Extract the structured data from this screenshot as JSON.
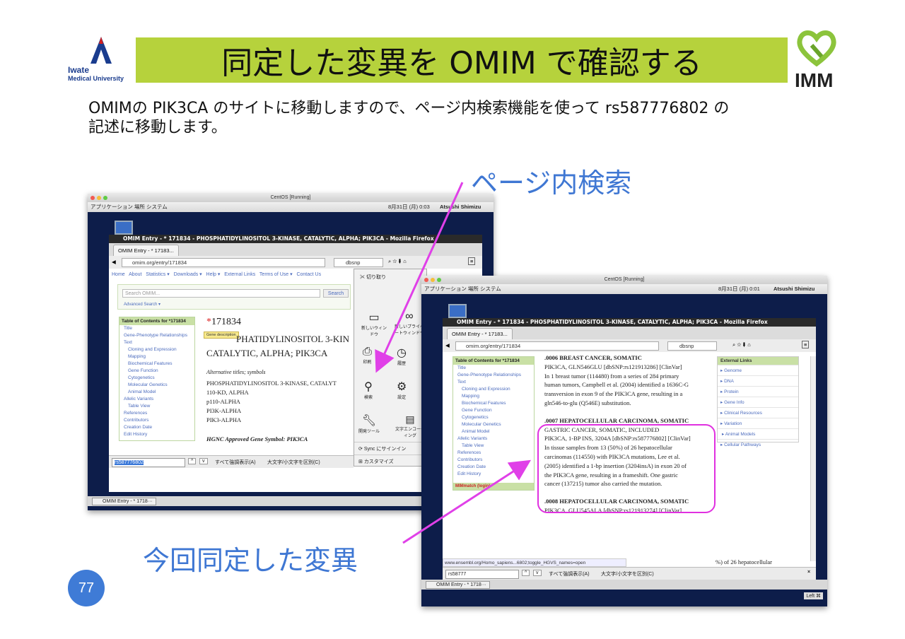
{
  "slide": {
    "logo_left_line1": "Iwate",
    "logo_left_line2": "Medical University",
    "title": "同定した変異を OMIM で確認する",
    "logo_right_text": "IMM",
    "intro_line1": "OMIMの PIK3CA のサイトに移動しますので、ページ内検索機能を使って rs587776802 の",
    "intro_line2": "記述に移動します。",
    "label_search": "ページ内検索",
    "label_mutation": "今回同定した変異",
    "page_number": "77",
    "arrow_color": "#e040e8"
  },
  "left": {
    "window_title": "CentOS [Running]",
    "gnome_menu": "アプリケーション  場所  システム",
    "clock": "8月31日 (月)  0:03",
    "user": "Atsushi Shimizu",
    "firefox_title": "OMIM Entry - * 171834 - PHOSPHATIDYLINOSITOL 3-KINASE, CATALYTIC, ALPHA; PIK3CA - Mozilla Firefox",
    "tab_label": "OMIM Entry - * 17183...",
    "url": "omim.org/entry/171834",
    "search_engine_text": "dbsnp",
    "nav": [
      "Home",
      "About",
      "Statistics ▾",
      "Downloads ▾",
      "Help ▾",
      "External Links",
      "Terms of Use ▾",
      "Contact Us"
    ],
    "search_placeholder": "Search OMIM...",
    "search_button": "Search",
    "advanced_search": "Advanced Search ▾",
    "toc_header": "Table of Contents for *171834",
    "toc": [
      "Title",
      "Gene-Phenotype Relationships",
      "Text",
      "Cloning and Expression",
      "Mapping",
      "Biochemical Features",
      "Gene Function",
      "Cytogenetics",
      "Molecular Genetics",
      "Animal Model",
      "Allelic Variants",
      "Table View",
      "References",
      "Contributors",
      "Creation Date",
      "Edit History"
    ],
    "entry_number": "171834",
    "tooltip": "Gene description",
    "gene_title_1": "PHATIDYLINOSITOL 3-KIN",
    "gene_title_2": "CATALYTIC, ALPHA; PIK3CA",
    "alt_titles": "Alternative titles; symbols",
    "alt_list": [
      "PHOSPHATIDYLINOSITOL 3-KINASE, CATALYT",
      "110-KD, ALPHA",
      "p110-ALPHA",
      "PI3K-ALPHA",
      "PIK3-ALPHA"
    ],
    "hgnc": "HGNC Approved Gene Symbol: PIK3CA",
    "menu_items": [
      "切り取り",
      "新しいウィンドウ",
      "新しいプライベートウィンドウ",
      "印刷",
      "履歴",
      "検索",
      "設定",
      "開発ツール",
      "文字エンコーディング"
    ],
    "menu_sync": "Sync にサインイン",
    "menu_customize": "カスタマイズ",
    "find_value": "rs587776802",
    "find_highlight_all": "すべて強調表示(A)",
    "find_match_case": "大文字/小文字を区別(C)",
    "taskbar_item": "OMIM Entry - * 1718···"
  },
  "right": {
    "window_title": "CentOS [Running]",
    "gnome_menu": "アプリケーション  場所  システム",
    "clock": "8月31日 (月)  0:01",
    "user": "Atsushi Shimizu",
    "firefox_title": "OMIM Entry - * 171834 - PHOSPHATIDYLINOSITOL 3-KINASE, CATALYTIC, ALPHA; PIK3CA - Mozilla Firefox",
    "tab_label": "OMIM Entry - * 17183...",
    "url": "omim.org/entry/171834",
    "search_engine_text": "dbsnp",
    "toc_header": "Table of Contents for *171834",
    "toc": [
      "Title",
      "Gene-Phenotype Relationships",
      "Text",
      "Cloning and Expression",
      "Mapping",
      "Biochemical Features",
      "Gene Function",
      "Cytogenetics",
      "Molecular Genetics",
      "Animal Model",
      "Allelic Variants",
      "Table View",
      "References",
      "Contributors",
      "Creation Date",
      "Edit History"
    ],
    "mimmatch": "MIMmatch (login)",
    "v6_title": ".0006  BREAST CANCER, SOMATIC",
    "v6_l1": "PIK3CA, GLN546GLU [dbSNP:rs121913286] [ClinVar]",
    "v6_l2": "In 1 breast tumor (114480) from a series of 284 primary",
    "v6_l3": "human tumors, Campbell et al. (2004) identified a 1636C-G",
    "v6_l4": "transversion in exon 9 of the PIK3CA gene, resulting in a",
    "v6_l5": "gln546-to-glu (Q546E) substitution.",
    "v7_title": ".0007  HEPATOCELLULAR CARCINOMA, SOMATIC",
    "v7_l1": "GASTRIC CANCER, SOMATIC, INCLUDED",
    "v7_l2": "PIK3CA, 1-BP INS, 3204A [dbSNP:rs587776802] [ClinVar]",
    "v7_l3": "In tissue samples from 13 (50%) of 26 hepatocellular",
    "v7_l4": "carcinomas (114550) with PIK3CA mutations, Lee et al.",
    "v7_l5": "(2005) identified a 1-bp insertion (3204insA) in exon 20 of",
    "v7_l6": "the PIK3CA gene, resulting in a frameshift. One gastric",
    "v7_l7": "cancer (137215) tumor also carried the mutation.",
    "v8_title": ".0008  HEPATOCELLULAR CARCINOMA, SOMATIC",
    "v8_l1": "PIK3CA, GLU545ALA [dbSNP:rs121913274] [ClinVar]",
    "v8_l2": "%) of 26 hepatocellular",
    "status_url": "www.ensembl.org/Homo_sapiens...6802;toggle_HGVS_names=open",
    "ext_header": "External Links",
    "ext_links": [
      "▸ Genome",
      "▸ DNA",
      "▸ Protein",
      "▸ Gene Info",
      "▸ Clinical Resources",
      "▸ Variation",
      "▸ Animal Models",
      "▸ Cellular Pathways"
    ],
    "find_value": "rs58777",
    "find_highlight_all": "すべて強調表示(A)",
    "find_match_case": "大文字/小文字を区別(C)",
    "taskbar_item": "OMIM Entry - * 1718···",
    "host_key": "Left ⌘"
  }
}
